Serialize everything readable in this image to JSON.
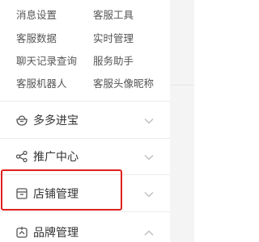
{
  "submenu": {
    "items": [
      {
        "label": "消息设置"
      },
      {
        "label": "客服工具"
      },
      {
        "label": "客服数据"
      },
      {
        "label": "实时管理"
      },
      {
        "label": "聊天记录查询"
      },
      {
        "label": "服务助手"
      },
      {
        "label": "客服机器人"
      },
      {
        "label": "客服头像昵称"
      }
    ]
  },
  "sections": [
    {
      "label": "多多进宝",
      "icon": "money-pot-icon",
      "chevron": "chevron-down"
    },
    {
      "label": "推广中心",
      "icon": "share-icon",
      "chevron": "chevron-down"
    },
    {
      "label": "店铺管理",
      "icon": "store-icon",
      "chevron": "chevron-down"
    },
    {
      "label": "品牌管理",
      "icon": "brand-icon",
      "chevron": "chevron-up"
    }
  ],
  "colors": {
    "highlight_border": "#e0201b",
    "icon": "#555555",
    "chevron": "#bbbbbb"
  }
}
